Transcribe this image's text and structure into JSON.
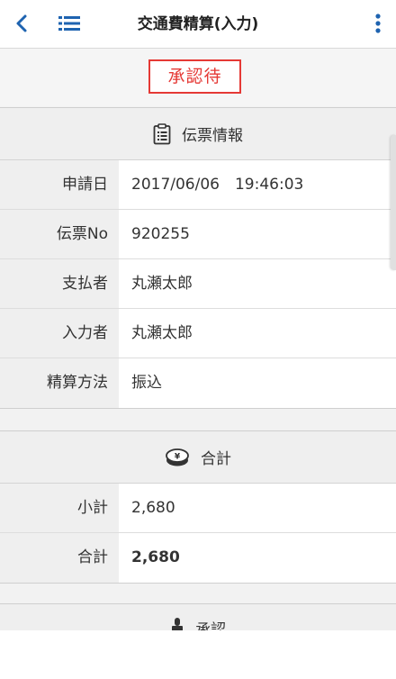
{
  "header": {
    "title": "交通費精算(入力)"
  },
  "status": {
    "label": "承認待",
    "color": "#e53935"
  },
  "voucher_section": {
    "title": "伝票情報",
    "icon": "clipboard-icon",
    "rows": [
      {
        "label": "申請日",
        "value": "2017/06/06　19:46:03"
      },
      {
        "label": "伝票No",
        "value": "920255"
      },
      {
        "label": "支払者",
        "value": "丸瀬太郎"
      },
      {
        "label": "入力者",
        "value": "丸瀬太郎"
      },
      {
        "label": "精算方法",
        "value": "振込"
      }
    ]
  },
  "total_section": {
    "title": "合計",
    "icon": "yen-coin-icon",
    "rows": [
      {
        "label": "小計",
        "value": "2,680"
      },
      {
        "label": "合計",
        "value": "2,680"
      }
    ]
  },
  "approval_section": {
    "title": "承認",
    "icon": "stamp-icon"
  },
  "colors": {
    "accent": "#1e63b0",
    "status": "#e53935"
  }
}
